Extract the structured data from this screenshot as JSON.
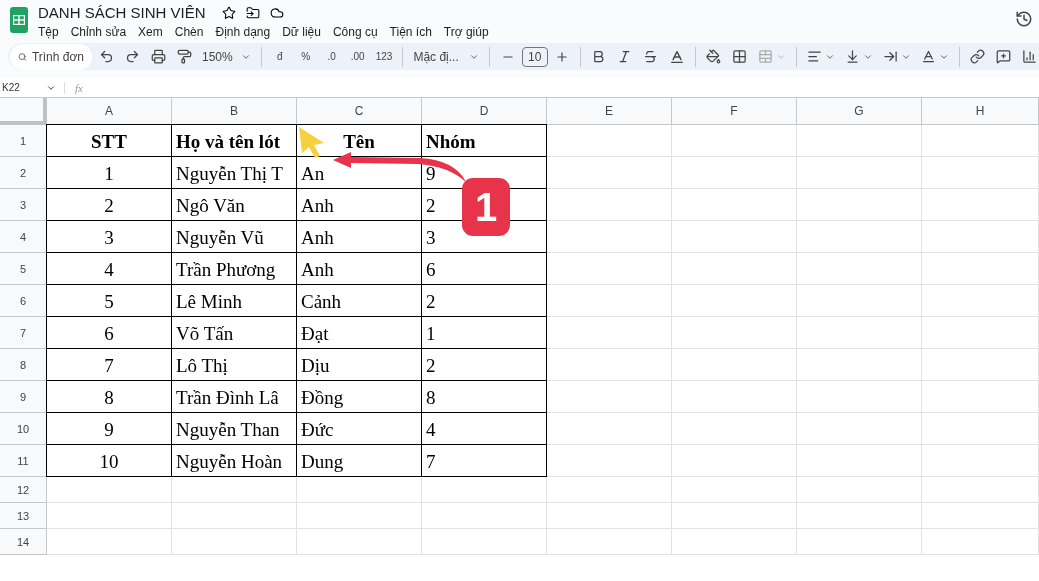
{
  "window": {
    "title": "DANH SÁCH SINH VIÊN"
  },
  "menu": [
    "Tệp",
    "Chỉnh sửa",
    "Xem",
    "Chèn",
    "Định dạng",
    "Dữ liệu",
    "Công cụ",
    "Tiện ích",
    "Trợ giúp"
  ],
  "toolbar": {
    "search_placeholder": "Trình đơn",
    "zoom": "150%",
    "number_formats": [
      "đ",
      "%",
      ".0",
      ".00",
      "123"
    ],
    "font": "Mặc đị...",
    "font_size": "10"
  },
  "formula_bar": {
    "cell_ref": "K22",
    "fx": "fx"
  },
  "sheet": {
    "columns": [
      "A",
      "B",
      "C",
      "D",
      "E",
      "F",
      "G",
      "H"
    ],
    "rows": [
      {
        "number": "1",
        "cells": [
          "STT",
          "Họ và tên lót",
          "Tên",
          "Nhóm"
        ]
      },
      {
        "number": "2",
        "cells": [
          "1",
          "Nguyễn Thị T",
          "An",
          "9"
        ]
      },
      {
        "number": "3",
        "cells": [
          "2",
          "Ngô Văn",
          "Anh",
          "2"
        ]
      },
      {
        "number": "4",
        "cells": [
          "3",
          "Nguyễn Vũ",
          "Anh",
          "3"
        ]
      },
      {
        "number": "5",
        "cells": [
          "4",
          "Trần Phương",
          "Anh",
          "6"
        ]
      },
      {
        "number": "6",
        "cells": [
          "5",
          "Lê Minh",
          "Cảnh",
          "2"
        ]
      },
      {
        "number": "7",
        "cells": [
          "6",
          "Võ Tấn",
          "Đạt",
          "1"
        ]
      },
      {
        "number": "8",
        "cells": [
          "7",
          "Lô Thị",
          "Dịu",
          "2"
        ]
      },
      {
        "number": "9",
        "cells": [
          "8",
          "Trần Đình Lâ",
          "Đồng",
          "8"
        ]
      },
      {
        "number": "10",
        "cells": [
          "9",
          "Nguyễn Than",
          "Đức",
          "4"
        ]
      },
      {
        "number": "11",
        "cells": [
          "10",
          "Nguyễn Hoàn",
          "Dung",
          "7"
        ]
      },
      {
        "number": "12"
      },
      {
        "number": "13"
      },
      {
        "number": "14"
      }
    ]
  },
  "annotation": {
    "badge": "1"
  }
}
